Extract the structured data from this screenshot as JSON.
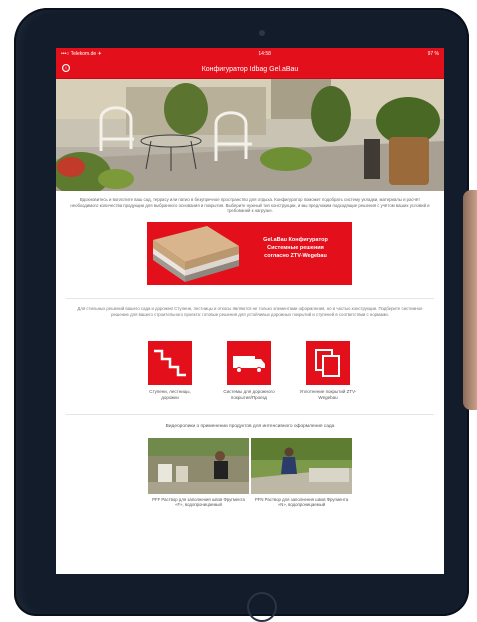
{
  "statusbar": {
    "carrier": "•••○ Telekom.de ✈",
    "time": "14:58",
    "battery": "97 %"
  },
  "navbar": {
    "title": "Конфигуратор Idbag Gel.aBau",
    "info_icon": "ⓘ"
  },
  "intro_text": "Вдохновитесь и воплотите ваш сад, террасу или патио в безупречное пространство для отдыха. Конфигуратор поможет подобрать систему укладки, материалы и расчёт необходимого количества продукции для выбранного основания и покрытия. Выберите нужный тип конструкции, и мы предложим подходящие решения с учётом ваших условий и требований к нагрузке.",
  "banner": {
    "line1": "Gel.aBau Конфигуратор",
    "line2": "Системные решения",
    "line3": "согласно ZTV-Wegebau"
  },
  "section2_text": "Для стильных решений вашего сада и дорожек! Ступени, лестницы и откосы являются не только элементами оформления, но и частью конструкции. Подберите системное решение для вашего строительного проекта: готовые решения для устойчивых дорожных покрытий и ступеней в соответствии с нормами.",
  "tiles": [
    {
      "label": "Ступени, лестницы, дорожки",
      "icon": "stairs-icon"
    },
    {
      "label": "Системы для дорожного покрытия/Проезд",
      "icon": "truck-icon"
    },
    {
      "label": "Уплотнение покрытий ZTV-Wegebau",
      "icon": "copy-icon"
    }
  ],
  "section3_title": "Видеоролики о применении продуктов для интенсивного оформления сада",
  "videos": [
    {
      "caption": "PFF Раствор для заполнения швов Фругмента «F», водопроницаемый"
    },
    {
      "caption": "PFN Раствор для заполнения швов Фругмента «N», водопроницаемый"
    }
  ],
  "colors": {
    "brand_red": "#e3101c",
    "bezel": "#131c2b"
  }
}
